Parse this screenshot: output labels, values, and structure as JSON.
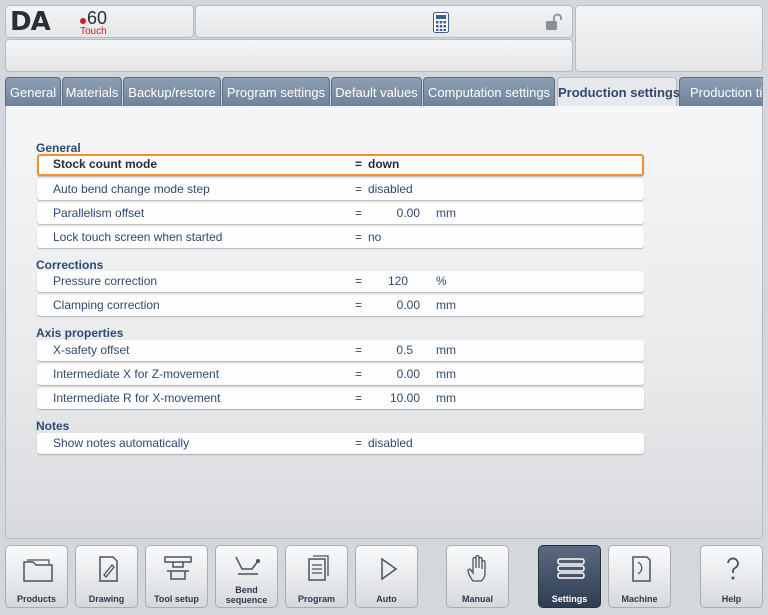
{
  "header": {
    "logo_brand": "DA",
    "logo_model": "60",
    "logo_sub": "Touch",
    "calculator_icon": "calculator-icon",
    "lock_icon": "unlocked-padlock-icon"
  },
  "tabs": [
    {
      "label": "General"
    },
    {
      "label": "Materials"
    },
    {
      "label": "Backup/restore"
    },
    {
      "label": "Program settings"
    },
    {
      "label": "Default values"
    },
    {
      "label": "Computation settings"
    },
    {
      "label": "Production settings",
      "active": true
    },
    {
      "label": "Production tin"
    }
  ],
  "sections": {
    "general": "General",
    "corrections": "Corrections",
    "axis": "Axis properties",
    "notes": "Notes"
  },
  "rows": {
    "stock_count_mode": {
      "label": "Stock count mode",
      "eq": "=",
      "value": "down"
    },
    "auto_bend_change": {
      "label": "Auto bend change mode step",
      "eq": "=",
      "value": "disabled"
    },
    "parallelism_offset": {
      "label": "Parallelism offset",
      "eq": "=",
      "value": "0.00",
      "unit": "mm"
    },
    "lock_touch_screen": {
      "label": "Lock touch screen when started",
      "eq": "=",
      "value": "no"
    },
    "pressure_correction": {
      "label": "Pressure correction",
      "eq": "=",
      "value": "120",
      "unit": "%"
    },
    "clamping_correction": {
      "label": "Clamping correction",
      "eq": "=",
      "value": "0.00",
      "unit": "mm"
    },
    "x_safety_offset": {
      "label": "X-safety offset",
      "eq": "=",
      "value": "0.5",
      "unit": "mm"
    },
    "intermediate_x": {
      "label": "Intermediate X for Z-movement",
      "eq": "=",
      "value": "0.00",
      "unit": "mm"
    },
    "intermediate_r": {
      "label": "Intermediate R for X-movement",
      "eq": "=",
      "value": "10.00",
      "unit": "mm"
    },
    "show_notes": {
      "label": "Show notes automatically",
      "eq": "=",
      "value": "disabled"
    }
  },
  "nav": {
    "products": "Products",
    "drawing": "Drawing",
    "tool_setup": "Tool setup",
    "bend_sequence_1": "Bend",
    "bend_sequence_2": "sequence",
    "program": "Program",
    "auto": "Auto",
    "manual": "Manual",
    "settings": "Settings",
    "machine": "Machine",
    "help": "Help"
  },
  "colors": {
    "accent_selected": "#e8913a",
    "tab_active_text": "#2f4a72",
    "tab_bg": "#7b8ea6"
  }
}
